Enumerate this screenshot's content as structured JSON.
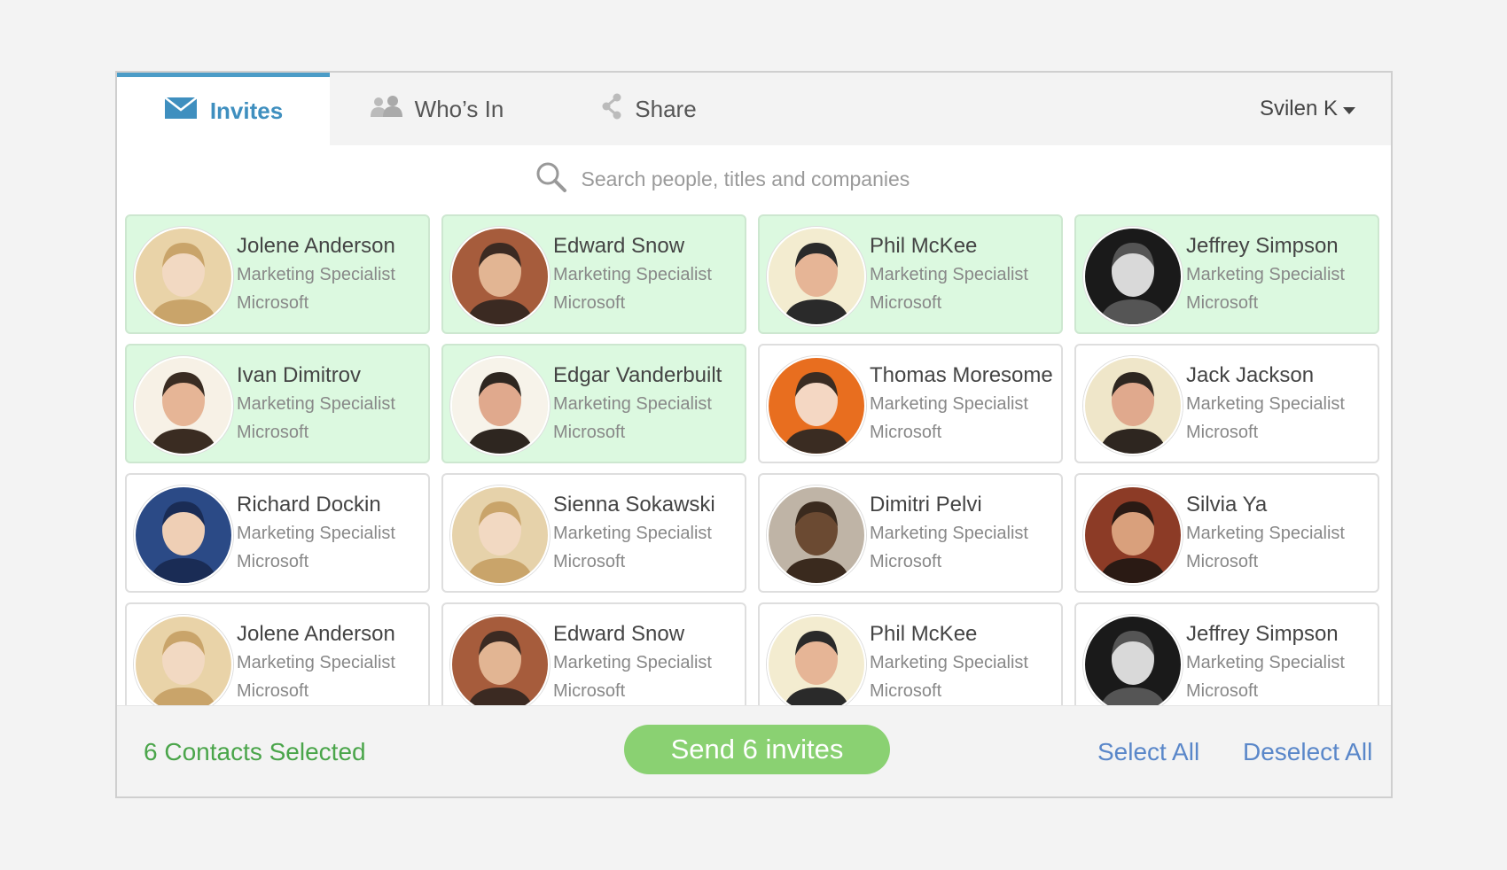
{
  "tabs": [
    {
      "label": "Invites",
      "icon": "envelope-icon",
      "active": true
    },
    {
      "label": "Who’s In",
      "icon": "people-icon",
      "active": false
    },
    {
      "label": "Share",
      "icon": "share-icon",
      "active": false
    }
  ],
  "user": {
    "name": "Svilen K"
  },
  "search": {
    "placeholder": "Search people, titles and companies",
    "value": ""
  },
  "contacts": [
    {
      "name": "Jolene Anderson",
      "title": "Marketing Specialist",
      "company": "Microsoft",
      "selected": true
    },
    {
      "name": "Edward Snow",
      "title": "Marketing Specialist",
      "company": "Microsoft",
      "selected": true
    },
    {
      "name": "Phil McKee",
      "title": "Marketing Specialist",
      "company": "Microsoft",
      "selected": true
    },
    {
      "name": "Jeffrey Simpson",
      "title": "Marketing Specialist",
      "company": "Microsoft",
      "selected": true
    },
    {
      "name": "Ivan Dimitrov",
      "title": "Marketing Specialist",
      "company": "Microsoft",
      "selected": true
    },
    {
      "name": "Edgar Vanderbuilt",
      "title": "Marketing Specialist",
      "company": "Microsoft",
      "selected": true
    },
    {
      "name": "Thomas Moresome",
      "title": "Marketing Specialist",
      "company": "Microsoft",
      "selected": false
    },
    {
      "name": "Jack Jackson",
      "title": "Marketing Specialist",
      "company": "Microsoft",
      "selected": false
    },
    {
      "name": "Richard Dockin",
      "title": "Marketing Specialist",
      "company": "Microsoft",
      "selected": false
    },
    {
      "name": "Sienna Sokawski",
      "title": "Marketing Specialist",
      "company": "Microsoft",
      "selected": false
    },
    {
      "name": "Dimitri Pelvi",
      "title": "Marketing Specialist",
      "company": "Microsoft",
      "selected": false
    },
    {
      "name": "Silvia Ya",
      "title": "Marketing Specialist",
      "company": "Microsoft",
      "selected": false
    },
    {
      "name": "Jolene Anderson",
      "title": "Marketing Specialist",
      "company": "Microsoft",
      "selected": false
    },
    {
      "name": "Edward Snow",
      "title": "Marketing Specialist",
      "company": "Microsoft",
      "selected": false
    },
    {
      "name": "Phil McKee",
      "title": "Marketing Specialist",
      "company": "Microsoft",
      "selected": false
    },
    {
      "name": "Jeffrey Simpson",
      "title": "Marketing Specialist",
      "company": "Microsoft",
      "selected": false
    }
  ],
  "footer": {
    "selected_count": "6 Contacts Selected",
    "send_label": "Send 6 invites",
    "select_all": "Select All",
    "deselect_all": "Deselect All"
  },
  "colors": {
    "accent_blue": "#3f8fbf",
    "selected_bg": "#dcf9e0",
    "send_green": "#8ad172",
    "count_green": "#4aa54a",
    "link_blue": "#5a87c9"
  }
}
